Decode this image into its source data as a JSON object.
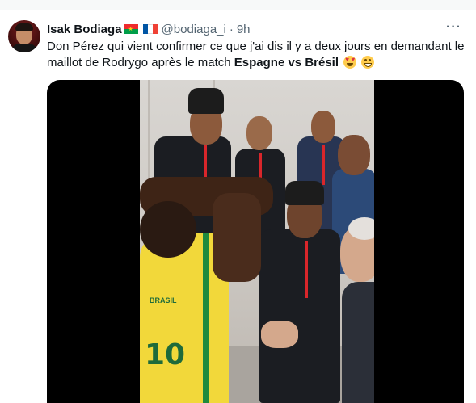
{
  "tweet": {
    "author_name": "Isak Bodiaga",
    "handle": "@bodiaga_i",
    "separator": "·",
    "time": "9h",
    "more": "···",
    "text_part1": "Don Pérez qui vient confirmer ce que j'ai dis il y a deux jours en demandant le maillot de Rodrygo après le match ",
    "text_bold": "Espagne vs Brésil",
    "emojis": [
      "smiling-face-with-heart-eyes",
      "grinning-face-with-smiling-eyes"
    ],
    "flags": [
      "burkina-faso-flag",
      "france-flag"
    ]
  },
  "media": {
    "type": "video",
    "jersey_number": "10",
    "jersey_badge": "BRASIL"
  },
  "colors": {
    "text": "#0f1419",
    "secondary": "#536471",
    "media_bg": "#000000",
    "jersey_yellow": "#f2d83a",
    "jersey_green": "#1f8a3d"
  }
}
